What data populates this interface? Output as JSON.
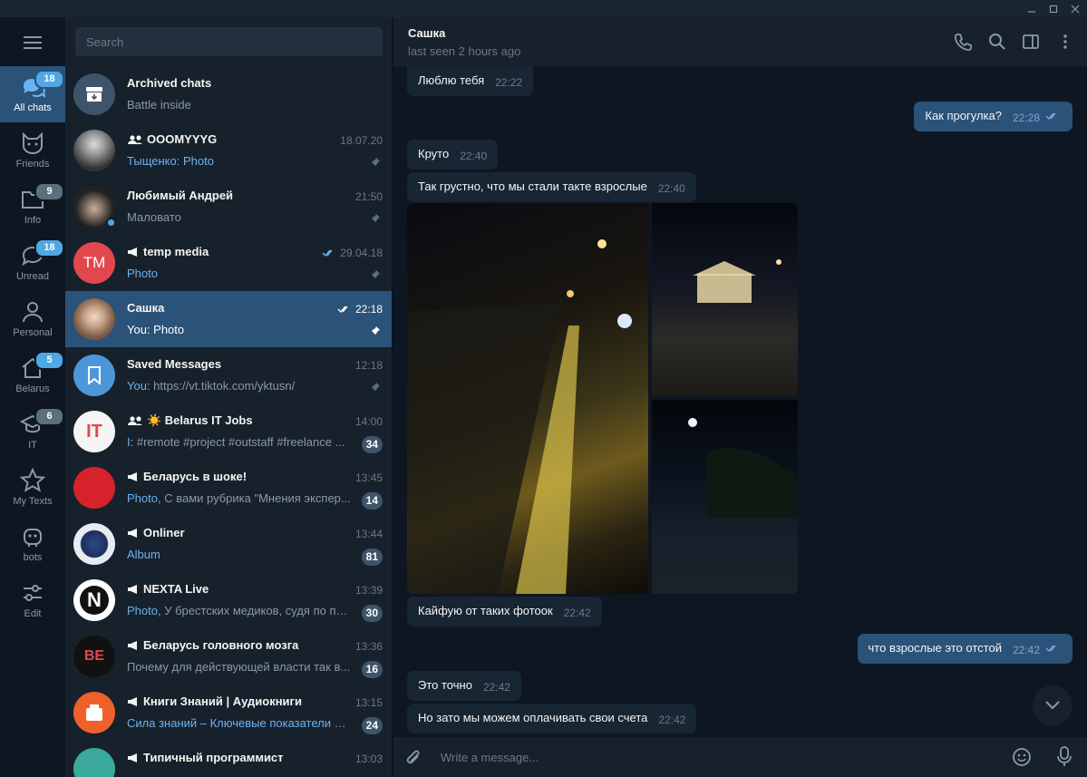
{
  "window": {
    "controls": [
      "minimize-icon",
      "maximize-icon",
      "close-icon"
    ]
  },
  "folders": [
    {
      "label": "All chats",
      "badge": "18",
      "icon": "chat-bubbles-icon"
    },
    {
      "label": "Friends",
      "badge": "",
      "icon": "cat-icon"
    },
    {
      "label": "Info",
      "badge": "9",
      "icon": "folder-icon"
    },
    {
      "label": "Unread",
      "badge": "18",
      "icon": "chat-bubble-icon"
    },
    {
      "label": "Personal",
      "badge": "",
      "icon": "person-icon"
    },
    {
      "label": "Belarus",
      "badge": "5",
      "icon": "home-icon"
    },
    {
      "label": "IT",
      "badge": "6",
      "icon": "graduation-cap-icon"
    },
    {
      "label": "My Texts",
      "badge": "",
      "icon": "star-icon"
    },
    {
      "label": "bots",
      "badge": "",
      "icon": "robot-icon"
    },
    {
      "label": "Edit",
      "badge": "",
      "icon": "sliders-icon"
    }
  ],
  "search": {
    "placeholder": "Search"
  },
  "chats": [
    {
      "name": "Archived chats",
      "time": "",
      "preview_prefix": "",
      "preview": "Battle inside",
      "badge": "",
      "pinned": false,
      "kind": "archive"
    },
    {
      "name": "OOOMYYYG",
      "time": "18.07.20",
      "preview_prefix": "Тыщенко: Photo",
      "preview": "",
      "badge": "",
      "pinned": true,
      "kind": "group"
    },
    {
      "name": "Любимый Андрей",
      "time": "21:50",
      "preview_prefix": "",
      "preview": "Маловато",
      "badge": "",
      "pinned": true,
      "kind": "user"
    },
    {
      "name": "temp media",
      "time": "29.04.18",
      "preview_prefix": "Photo",
      "preview": "",
      "badge": "",
      "pinned": true,
      "kind": "channel",
      "avatar_text": "TM"
    },
    {
      "name": "Сашка",
      "time": "22:18",
      "preview_prefix": "",
      "preview": "You: Photo",
      "badge": "",
      "pinned": true,
      "kind": "user"
    },
    {
      "name": "Saved Messages",
      "time": "12:18",
      "preview_prefix": "You:",
      "preview": " https://vt.tiktok.com/yktusn/",
      "badge": "",
      "pinned": true,
      "kind": "saved"
    },
    {
      "name": "☀️ Belarus IT Jobs",
      "time": "14:00",
      "preview_prefix": "I:",
      "preview": " #remote #project #outstaff #freelance ...",
      "badge": "34",
      "pinned": false,
      "kind": "group"
    },
    {
      "name": "Беларусь в шоке!",
      "time": "13:45",
      "preview_prefix": "Photo,",
      "preview": " С вами рубрика \"Мнения экспер...",
      "badge": "14",
      "pinned": false,
      "kind": "channel"
    },
    {
      "name": "Onliner",
      "time": "13:44",
      "preview_prefix": "Album",
      "preview": "",
      "badge": "81",
      "pinned": false,
      "kind": "channel"
    },
    {
      "name": "NEXTA Live",
      "time": "13:39",
      "preview_prefix": "Photo,",
      "preview": " У брестских медиков, судя по пи...",
      "badge": "30",
      "pinned": false,
      "kind": "channel"
    },
    {
      "name": "Беларусь головного мозга",
      "time": "13:36",
      "preview_prefix": "",
      "preview": "Почему для действующей власти так в...",
      "badge": "16",
      "pinned": false,
      "kind": "channel"
    },
    {
      "name": "Книги Знаний | Аудиокниги",
      "time": "13:15",
      "preview_prefix": "Сила знаний – Ключевые показатели м...",
      "preview": "",
      "badge": "24",
      "pinned": false,
      "kind": "channel"
    },
    {
      "name": "Типичный программист",
      "time": "13:03",
      "preview_prefix": "",
      "preview": "",
      "badge": "",
      "pinned": false,
      "kind": "channel"
    }
  ],
  "header": {
    "name": "Сашка",
    "status": "last seen 2 hours ago"
  },
  "messages": [
    {
      "text": "Люблю тебя",
      "time": "22:22",
      "out": false
    },
    {
      "text": "Как прогулка?",
      "time": "22:28",
      "out": true
    },
    {
      "text": "Круто",
      "time": "22:40",
      "out": false
    },
    {
      "text": "Так грустно, что мы стали такте взрослые",
      "time": "22:40",
      "out": false
    },
    {
      "text": "Кайфую от таких фотоок",
      "time": "22:42",
      "out": false
    },
    {
      "text": "что взрослые это отстой",
      "time": "22:42",
      "out": true
    },
    {
      "text": "Это точно",
      "time": "22:42",
      "out": false
    },
    {
      "text": "Но зато мы можем оплачивать свои счета",
      "time": "22:42",
      "out": false
    }
  ],
  "composer": {
    "placeholder": "Write a message..."
  },
  "colors": {
    "accent": "#2b5278",
    "link": "#6ab3f3",
    "badge": "#4fa7e4",
    "bg": "#0e1621",
    "panel": "#17212b"
  }
}
